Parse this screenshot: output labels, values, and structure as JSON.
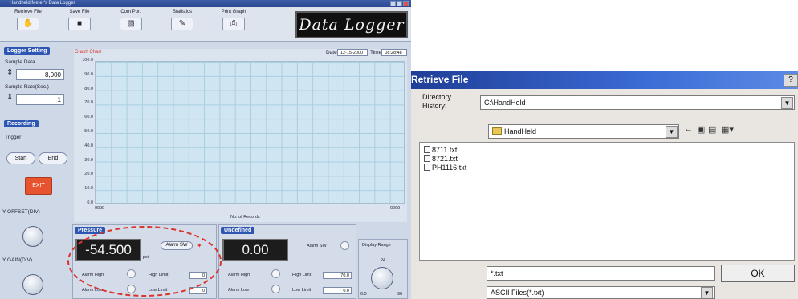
{
  "app": {
    "title": "Handheld Meter's Data Logger",
    "toolbar": [
      {
        "label": "Retrieve File",
        "icon": "hand-icon"
      },
      {
        "label": "Save File",
        "icon": "floppy-icon"
      },
      {
        "label": "Com Port",
        "icon": "port-icon"
      },
      {
        "label": "Statistics",
        "icon": "stats-icon"
      },
      {
        "label": "Print Graph",
        "icon": "printer-icon"
      }
    ],
    "logo": "Data Logger",
    "logger_setting": {
      "title": "Logger Setting",
      "sample_data_label": "Sample Data",
      "sample_data_value": "8,000",
      "sample_rate_label": "Sample Rate(Sec.)",
      "sample_rate_value": "1"
    },
    "recording": {
      "title": "Recording",
      "trigger_label": "Trigger",
      "start": "Start",
      "end": "End",
      "exit": "EXIT"
    },
    "offset_label": "Y OFFSET(DIV)",
    "gain_label": "Y GAIN(DIV)",
    "graph": {
      "title": "Graph Chart",
      "date_label": "Date",
      "date_value": "12-15-2000",
      "time_label": "Time",
      "time_value": "08:28:48",
      "yticks": [
        "100.0",
        "90.0",
        "80.0",
        "70.0",
        "60.0",
        "50.0",
        "40.0",
        "30.0",
        "20.0",
        "10.0",
        "0.0"
      ],
      "x_start": "0000",
      "x_end": "0000",
      "xlabel": "No. of Records"
    },
    "pressure": {
      "title": "Pressure",
      "value": "-54.500",
      "unit": "psi",
      "alarm_sw": "Alarm SW",
      "alarm_high": "Alarm High",
      "alarm_low": "Alarm Low",
      "high_limit": "High Limit",
      "high_value": "0",
      "low_limit": "Low Limit",
      "low_value": "0"
    },
    "undefined": {
      "title": "Undefined",
      "value": "0.00",
      "alarm_sw": "Alarm SW",
      "alarm_high": "Alarm High",
      "alarm_low": "Alarm Low",
      "high_limit": "High Limit",
      "high_value": "70.0",
      "low_limit": "Low Limit",
      "low_value": "0.0"
    },
    "display_range": {
      "label": "Display Range",
      "marks": [
        "24",
        "0.5",
        "96"
      ]
    }
  },
  "dialog": {
    "title": "Retrieve File",
    "help": "?",
    "directory_history_label": "Directory\nHistory:",
    "directory_value": "C:\\HandHeld",
    "folder_value": "HandHeld",
    "files": [
      "8711.txt",
      "8721.txt",
      "PH1116.txt"
    ],
    "filename_value": "*.txt",
    "filetype_value": "ASCII Files(*.txt)",
    "ok_label": "OK"
  },
  "colors": {
    "accent": "#2d56b3",
    "lcd": "#1c1c1c",
    "exit": "#e8532f",
    "annotation": "#d8342b"
  }
}
